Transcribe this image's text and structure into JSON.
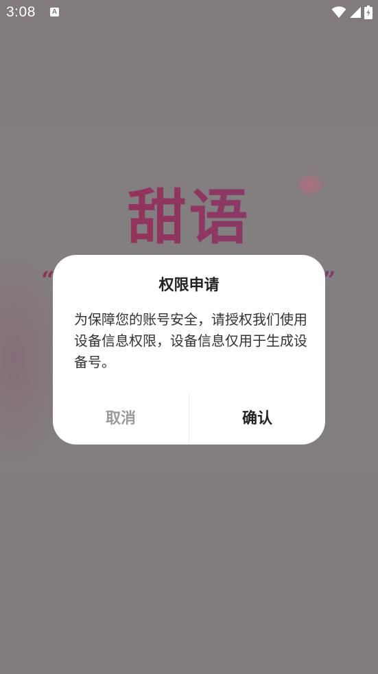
{
  "status_bar": {
    "time": "3:08",
    "notification_icon": "A",
    "icons": [
      "wifi-icon",
      "signal-icon",
      "battery-icon"
    ]
  },
  "background": {
    "app_title": "甜语",
    "quote_open": "“",
    "quote_close": "”",
    "accent_color": "#8c3864"
  },
  "dialog": {
    "title": "权限申请",
    "message": "为保障您的账号安全，请授权我们使用设备信息权限，设备信息仅用于生成设备号。",
    "cancel_label": "取消",
    "confirm_label": "确认"
  }
}
